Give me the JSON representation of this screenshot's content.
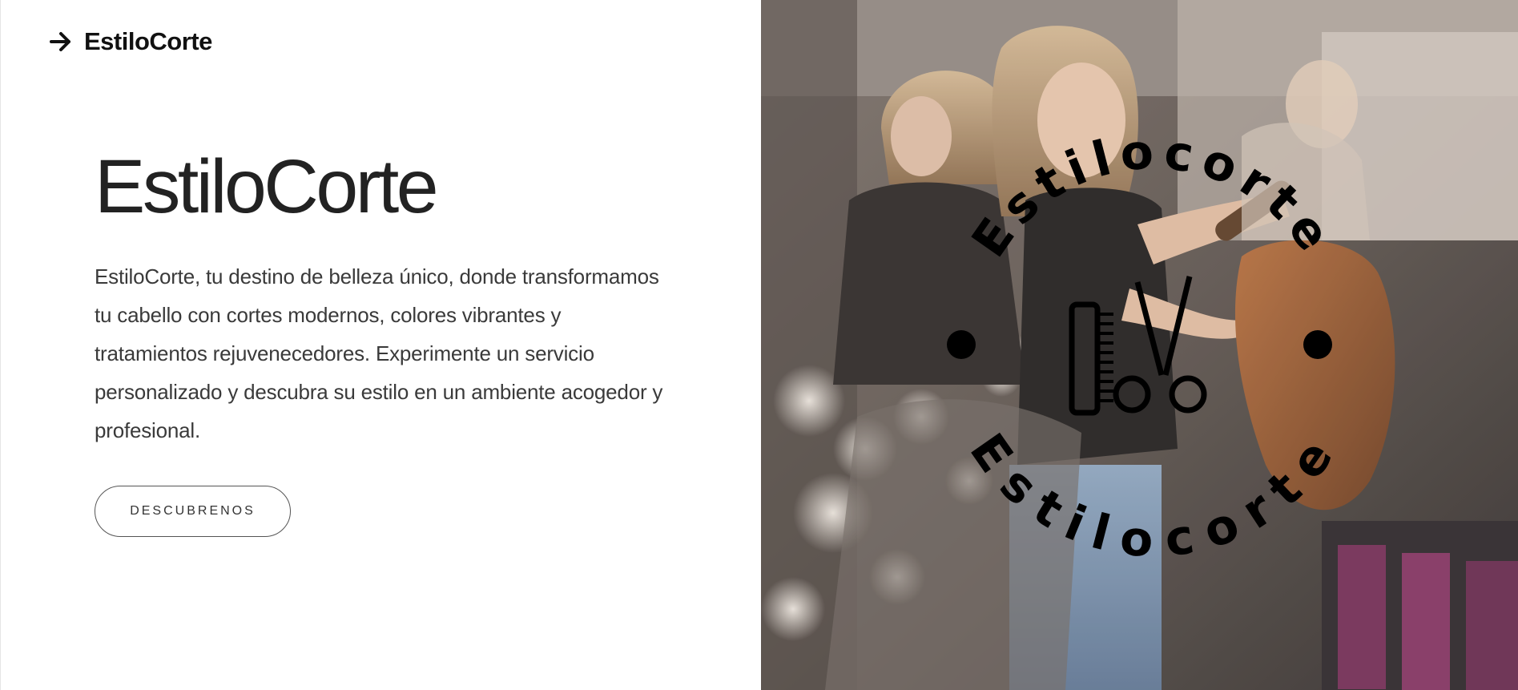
{
  "header": {
    "brand_text": "EstiloCorte",
    "brand_icon": "arrow-right-icon"
  },
  "hero": {
    "title": "EstiloCorte",
    "description": "EstiloCorte, tu destino de belleza único, donde transformamos tu cabello con cortes modernos, colores vibrantes y tratamientos rejuvenecedores. Experimente un servicio personalizado y descubra su estilo en un ambiente acogedor y profesional.",
    "cta_label": "DESCUBRENOS"
  },
  "logo": {
    "ring_top_text": "Estilocorte",
    "ring_bottom_text": "Estilocorte",
    "center_icons": [
      "comb-icon",
      "scissors-icon"
    ]
  },
  "colors": {
    "background": "#ffffff",
    "text": "#222222",
    "logo": "#000000"
  }
}
